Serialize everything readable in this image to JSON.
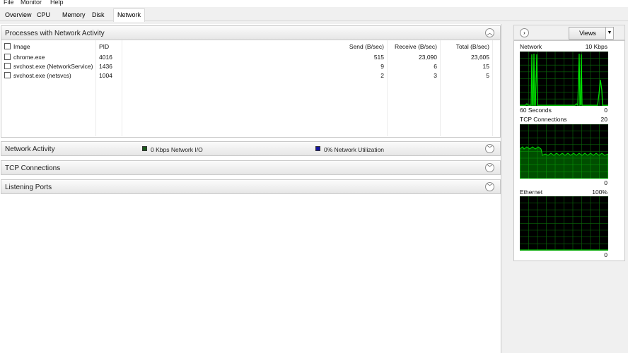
{
  "menu": {
    "file": "File",
    "monitor": "Monitor",
    "help": "Help"
  },
  "tabs": {
    "overview": "Overview",
    "cpu": "CPU",
    "memory": "Memory",
    "disk": "Disk",
    "network": "Network"
  },
  "processes": {
    "title": "Processes with Network Activity",
    "columns": {
      "image": "Image",
      "pid": "PID",
      "send": "Send (B/sec)",
      "receive": "Receive (B/sec)",
      "total": "Total (B/sec)"
    },
    "rows": [
      {
        "image": "chrome.exe",
        "pid": "4016",
        "send": "515",
        "receive": "23,090",
        "total": "23,605"
      },
      {
        "image": "svchost.exe (NetworkService)",
        "pid": "1436",
        "send": "9",
        "receive": "6",
        "total": "15"
      },
      {
        "image": "svchost.exe (netsvcs)",
        "pid": "1004",
        "send": "2",
        "receive": "3",
        "total": "5"
      }
    ]
  },
  "network_activity": {
    "title": "Network Activity",
    "io_label": "0 Kbps Network I/O",
    "util_label": "0% Network Utilization",
    "io_color": "#1c5a1c",
    "util_color": "#1515a0"
  },
  "tcp": {
    "title": "TCP Connections"
  },
  "listening": {
    "title": "Listening Ports"
  },
  "side": {
    "views_label": "Views",
    "network": {
      "title": "Network",
      "scale": "10 Kbps",
      "time": "60 Seconds",
      "min": "0"
    },
    "tcp": {
      "title": "TCP Connections",
      "scale": "20",
      "min": "0"
    },
    "ethernet": {
      "title": "Ethernet",
      "scale": "100%",
      "min": "0"
    }
  },
  "graph_color": "#00e000",
  "graph_grid_color": "#0a6b0a"
}
